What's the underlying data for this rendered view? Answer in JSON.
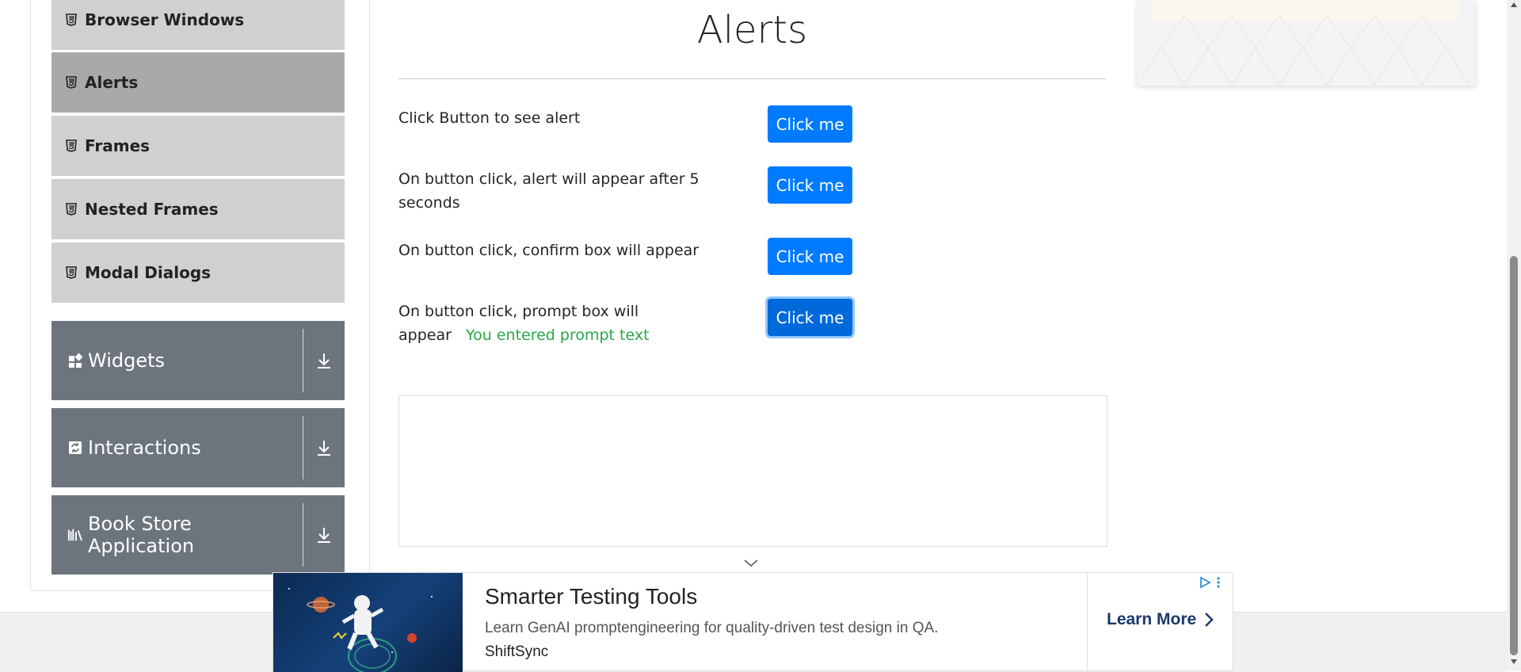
{
  "sidebar": {
    "sub_items": [
      {
        "label": "Browser Windows",
        "icon": "html5-icon",
        "active": false
      },
      {
        "label": "Alerts",
        "icon": "html5-icon",
        "active": true
      },
      {
        "label": "Frames",
        "icon": "html5-icon",
        "active": false
      },
      {
        "label": "Nested Frames",
        "icon": "html5-icon",
        "active": false
      },
      {
        "label": "Modal Dialogs",
        "icon": "html5-icon",
        "active": false
      }
    ],
    "groups": [
      {
        "label": "Widgets",
        "icon": "grid-icon"
      },
      {
        "label": "Interactions",
        "icon": "sync-icon"
      },
      {
        "label": "Book Store Application",
        "icon": "books-icon"
      }
    ]
  },
  "main": {
    "title": "Alerts",
    "rows": [
      {
        "text": "Click Button to see alert",
        "button": "Click me",
        "result": ""
      },
      {
        "text": "On button click, alert will appear after 5 seconds",
        "button": "Click me",
        "result": ""
      },
      {
        "text": "On button click, confirm box will appear",
        "button": "Click me",
        "result": ""
      },
      {
        "text": "On button click, prompt box will appear",
        "button": "Click me",
        "result": "You entered prompt text"
      }
    ]
  },
  "ad": {
    "title": "Smarter Testing Tools",
    "description": "Learn GenAI promptengineering for quality-driven test design in QA.",
    "brand": "ShiftSync",
    "cta": "Learn More"
  },
  "colors": {
    "primary": "#007bff",
    "sidebar_group": "#6c757d",
    "sidebar_item": "#d0d0d0",
    "sidebar_item_active": "#a9a9a9",
    "success": "#28a745"
  }
}
